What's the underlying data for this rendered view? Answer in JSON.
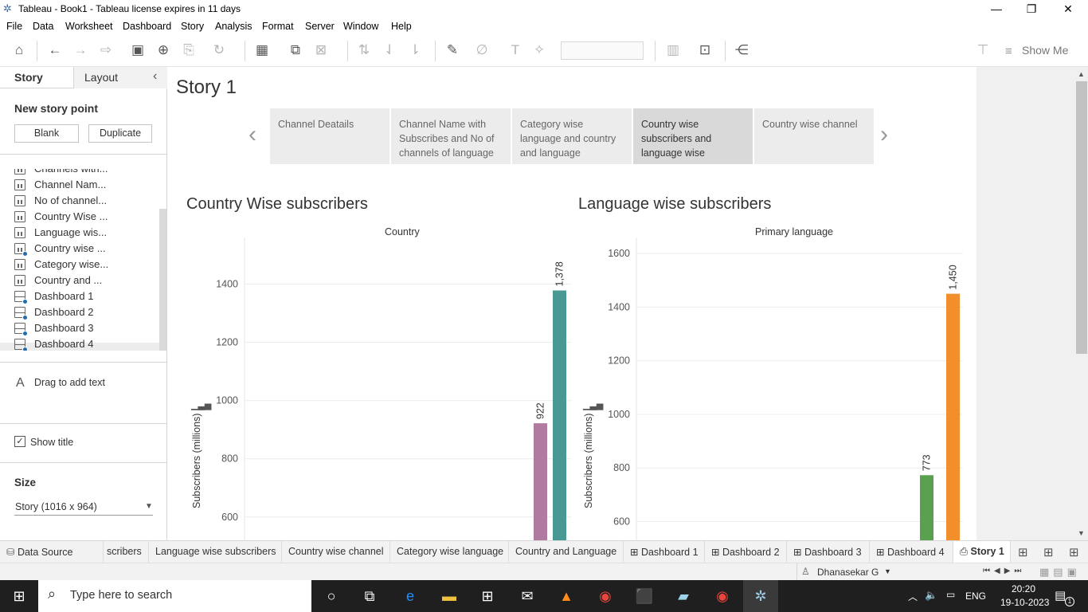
{
  "window": {
    "title": "Tableau - Book1 - Tableau license expires in 11 days",
    "minimize": "—",
    "maximize": "❐",
    "close": "✕"
  },
  "menu": [
    "File",
    "Data",
    "Worksheet",
    "Dashboard",
    "Story",
    "Analysis",
    "Format",
    "Server",
    "Window",
    "Help"
  ],
  "toolbar": {
    "show_me": "Show Me"
  },
  "left_panel": {
    "tab_story": "Story",
    "tab_layout": "Layout",
    "collapse_icon": "‹",
    "new_story_point": "New story point",
    "blank_btn": "Blank",
    "duplicate_btn": "Duplicate",
    "sheets": [
      {
        "label": "Channels with...",
        "kind": "sheet",
        "used": false
      },
      {
        "label": "Channel Nam...",
        "kind": "sheet",
        "used": false
      },
      {
        "label": "No of channel...",
        "kind": "sheet",
        "used": false
      },
      {
        "label": "Country Wise ...",
        "kind": "sheet",
        "used": false
      },
      {
        "label": "Language wis...",
        "kind": "sheet",
        "used": false
      },
      {
        "label": "Country wise ...",
        "kind": "sheet",
        "used": true
      },
      {
        "label": "Category wise...",
        "kind": "sheet",
        "used": false
      },
      {
        "label": "Country and ...",
        "kind": "sheet",
        "used": false
      },
      {
        "label": "Dashboard 1",
        "kind": "dashboard",
        "used": true
      },
      {
        "label": "Dashboard 2",
        "kind": "dashboard",
        "used": true
      },
      {
        "label": "Dashboard 3",
        "kind": "dashboard",
        "used": true
      },
      {
        "label": "Dashboard 4",
        "kind": "dashboard",
        "used": true
      }
    ],
    "drag_text": "Drag to add text",
    "show_title": "Show title",
    "size_label": "Size",
    "size_value": "Story (1016 x 964)"
  },
  "story": {
    "title": "Story 1",
    "points": [
      {
        "label": "Channel Deatails",
        "selected": false
      },
      {
        "label": "Channel Name with Subscribes and No of channels of language",
        "selected": false
      },
      {
        "label": "Category wise language and country and language",
        "selected": false
      },
      {
        "label": "Country wise subscribers and language wise",
        "selected": true
      },
      {
        "label": "Country wise channel",
        "selected": false
      }
    ]
  },
  "chart_data": [
    {
      "type": "bar",
      "title": "Country Wise subscribers",
      "column_header": "Country",
      "ylabel": "Subscribers (millions)",
      "yticks": [
        600,
        800,
        1000,
        1200,
        1400
      ],
      "ylim": [
        520,
        1560
      ],
      "bars": [
        {
          "value": 922,
          "label": "922",
          "color": "#b07aa1"
        },
        {
          "value": 1378,
          "label": "1,378",
          "color": "#499894"
        }
      ]
    },
    {
      "type": "bar",
      "title": "Language wise subscribers",
      "column_header": "Primary language",
      "ylabel": "Subscribers (millions)",
      "yticks": [
        600,
        800,
        1000,
        1200,
        1400,
        1600
      ],
      "ylim": [
        530,
        1660
      ],
      "bars": [
        {
          "value": 773,
          "label": "773",
          "color": "#59a14f"
        },
        {
          "value": 1450,
          "label": "1,450",
          "color": "#f28e2b"
        }
      ]
    }
  ],
  "sheet_tabs": [
    "Data Source",
    "scribers",
    "Language wise subscribers",
    "Country wise channel",
    "Category wise language",
    "Country and Language",
    "Dashboard 1",
    "Dashboard 2",
    "Dashboard 3",
    "Dashboard 4",
    "Story 1"
  ],
  "status": {
    "user": "Dhanasekar G"
  },
  "taskbar": {
    "search_placeholder": "Type here to search",
    "lang": "ENG",
    "time": "20:20",
    "date": "19-10-2023",
    "notif_count": "1"
  }
}
